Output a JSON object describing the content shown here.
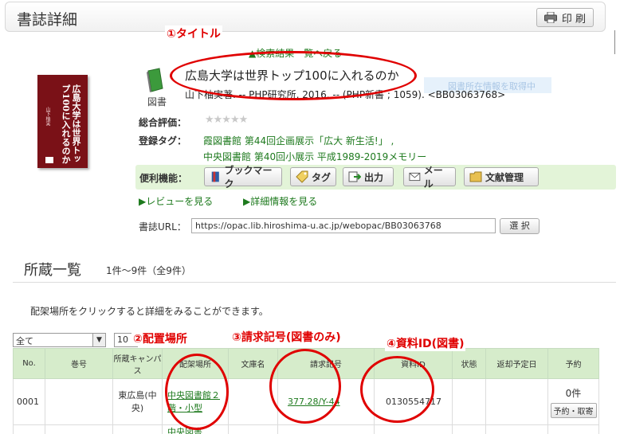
{
  "header": {
    "title": "書誌詳細",
    "print_label": "印 刷"
  },
  "book": {
    "type_label": "図書",
    "back_link": "▲検索結果一覧へ戻る",
    "title": "広島大学は世界トップ100に入れるのか",
    "pub_info": "山下柚実著. -- PHP研究所, 2016. -- (PHP新書 ; 1059). <BB03063768>",
    "faded_note": "図書所在情報を取得中",
    "cover_title": "広島大学は世界トップ100に入れるのか",
    "cover_author": "山下柚実"
  },
  "fields": {
    "rating_label": "総合評価：",
    "rating_stars": "★★★★★",
    "rating_value": 0,
    "tags_label": "登録タグ：",
    "tags": [
      "霞図書館 第44回企画展示「広大 新生活!」 ,",
      "中央図書館 第40回小展示 平成1989-2019メモリー"
    ]
  },
  "functions": {
    "label": "便利機能：",
    "buttons": [
      "ブックマーク",
      "タグ",
      "出力",
      "メール",
      "文献管理"
    ]
  },
  "links": {
    "review": "▶レビューを見る",
    "detail": "▶詳細情報を見る"
  },
  "url": {
    "label": "書誌URL：",
    "value": "https://opac.lib.hiroshima-u.ac.jp/webopac/BB03063768",
    "select_label": "選 択"
  },
  "holdings": {
    "title": "所蔵一覧",
    "count": "1件～9件（全9件）",
    "instruction": "配架場所をクリックすると詳細をみることができます。",
    "filter_value": "全て",
    "per_page_value": "10件",
    "columns": [
      "No.",
      "巻号",
      "所蔵キャンパス",
      "配架場所",
      "文庫名",
      "請求記号",
      "資料ID",
      "状態",
      "返却予定日",
      "予約"
    ],
    "row": {
      "no": "0001",
      "volume": "",
      "campus": "東広島(中央)",
      "location": "中央図書館２階・小型",
      "library": "",
      "call_number": "377.28/Y-44",
      "item_id": "0130554717",
      "status": "",
      "due": "",
      "reserve_count": "0件",
      "reserve_button": "予約・取寄"
    },
    "row2_location": "中央図書"
  },
  "annotations": {
    "title": "①タイトル",
    "location": "②配置場所",
    "call": "③請求記号(図書のみ)",
    "id": "④資料ID(図書)"
  },
  "colors": {
    "annotation": "#e00000",
    "link": "#1e7a1e",
    "table_header": "#d6eccb",
    "function_bar": "#e3f4d8"
  }
}
